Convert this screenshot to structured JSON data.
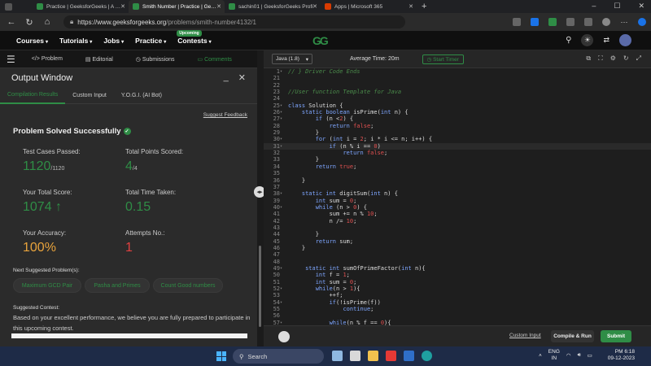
{
  "browser": {
    "tabs": [
      {
        "title": "Practice | GeeksforGeeks | A com",
        "color": "#2f8d46"
      },
      {
        "title": "Smith Number | Practice | Geeksf",
        "color": "#2f8d46",
        "active": true
      },
      {
        "title": "sachin01 | GeeksforGeeks Profi",
        "color": "#2f8d46"
      },
      {
        "title": "Apps | Microsoft 365",
        "color": "#d83b01"
      }
    ],
    "new_tab": "+",
    "url_host": "https://www.geeksforgeeks.org",
    "url_path": "/problems/smith-number4132/1"
  },
  "site": {
    "logo": "GG",
    "nav": [
      {
        "label": "Courses"
      },
      {
        "label": "Tutorials"
      },
      {
        "label": "Jobs"
      },
      {
        "label": "Practice"
      },
      {
        "label": "Contests",
        "badge": "Upcoming"
      }
    ]
  },
  "problem_tabs": [
    "Problem",
    "Editorial",
    "Submissions",
    "Comments"
  ],
  "output_window": {
    "title": "Output Window",
    "tabs": [
      "Compilation Results",
      "Custom Input",
      "Y.O.G.I. (AI Bot)"
    ],
    "suggest_feedback": "Suggest Feedback",
    "status": "Problem Solved Successfully",
    "stats": {
      "test_cases_label": "Test Cases Passed:",
      "test_cases_value": "1120",
      "test_cases_total": "/1120",
      "points_label": "Total Points Scored:",
      "points_value": "4",
      "points_total": "/4",
      "score_label": "Your Total Score:",
      "score_value": "1074",
      "time_label": "Total Time Taken:",
      "time_value": "0.15",
      "accuracy_label": "Your Accuracy:",
      "accuracy_value": "100%",
      "attempts_label": "Attempts No.:",
      "attempts_value": "1"
    },
    "next_label": "Next Suggested Problem(s):",
    "next_problems": [
      "Maximum GCD Pair",
      "Pasha and Primes",
      "Count Good numbers"
    ],
    "contest_label": "Suggested Contest:",
    "contest_text": "Based on your excellent performance, we believe you are fully prepared to participate in this upcoming contest."
  },
  "editor": {
    "language": "Java (1.8)",
    "avg_time": "Average Time: 20m",
    "timer_label": "Start Timer",
    "custom_input": "Custom Input",
    "compile_label": "Compile & Run",
    "submit_label": "Submit",
    "lines": [
      {
        "n": "1",
        "arrow": "›",
        "html": "<span class='c'>// } Driver Code Ends</span>"
      },
      {
        "n": "21",
        "html": ""
      },
      {
        "n": "22",
        "html": ""
      },
      {
        "n": "23",
        "html": "<span class='c'>//User function Template for Java</span>"
      },
      {
        "n": "24",
        "html": ""
      },
      {
        "n": "25",
        "arrow": "▾",
        "html": "<span class='k'>class</span> <span class='p'>Solution {</span>"
      },
      {
        "n": "26",
        "arrow": "▾",
        "html": "    <span class='k'>static boolean</span> <span class='p'>isPrime(</span><span class='k'>int</span> <span class='p'>n) {</span>"
      },
      {
        "n": "27",
        "arrow": "▾",
        "html": "        <span class='k'>if</span> <span class='p'>(n &lt;</span><span class='n'>2</span><span class='p'>) {</span>"
      },
      {
        "n": "28",
        "html": "            <span class='k'>return</span> <span class='s'>false</span><span class='p'>;</span>"
      },
      {
        "n": "29",
        "html": "        <span class='p'>}</span>"
      },
      {
        "n": "30",
        "arrow": "▾",
        "html": "        <span class='k'>for</span> <span class='p'>(</span><span class='k'>int</span> <span class='p'>i = </span><span class='n'>2</span><span class='p'>; i * i &lt;= n; i++) {</span>"
      },
      {
        "n": "31",
        "arrow": "▾",
        "hl": true,
        "html": "            <span class='k'>if</span> <span class='p'>(n % i == </span><span class='n'>0</span><span class='p'>)</span>"
      },
      {
        "n": "32",
        "html": "                <span class='k'>return</span> <span class='s'>false</span><span class='p'>;</span>"
      },
      {
        "n": "33",
        "html": "        <span class='p'>}</span>"
      },
      {
        "n": "34",
        "html": "        <span class='k'>return</span> <span class='s'>true</span><span class='p'>;</span>"
      },
      {
        "n": "35",
        "html": ""
      },
      {
        "n": "36",
        "html": "    <span class='p'>}</span>"
      },
      {
        "n": "37",
        "html": ""
      },
      {
        "n": "38",
        "arrow": "▾",
        "html": "    <span class='k'>static int</span> <span class='p'>digitSum(</span><span class='k'>int</span> <span class='p'>n) {</span>"
      },
      {
        "n": "39",
        "html": "        <span class='k'>int</span> <span class='p'>sum = </span><span class='n'>0</span><span class='p'>;</span>"
      },
      {
        "n": "40",
        "arrow": "▾",
        "html": "        <span class='k'>while</span> <span class='p'>(n &gt; </span><span class='n'>0</span><span class='p'>) {</span>"
      },
      {
        "n": "41",
        "html": "            <span class='p'>sum += n % </span><span class='n'>10</span><span class='p'>;</span>"
      },
      {
        "n": "42",
        "html": "            <span class='p'>n /= </span><span class='n'>10</span><span class='p'>;</span>"
      },
      {
        "n": "43",
        "html": ""
      },
      {
        "n": "44",
        "html": "        <span class='p'>}</span>"
      },
      {
        "n": "45",
        "html": "        <span class='k'>return</span> <span class='p'>sum;</span>"
      },
      {
        "n": "46",
        "html": "    <span class='p'>}</span>"
      },
      {
        "n": "47",
        "html": ""
      },
      {
        "n": "48",
        "html": ""
      },
      {
        "n": "49",
        "arrow": "▾",
        "html": "     <span class='k'>static int</span> <span class='p'>sumOfPrimeFactor(</span><span class='k'>int</span> <span class='p'>n){</span>"
      },
      {
        "n": "50",
        "html": "        <span class='k'>int</span> <span class='p'>f = </span><span class='n'>1</span><span class='p'>;</span>"
      },
      {
        "n": "51",
        "html": "        <span class='k'>int</span> <span class='p'>sum = </span><span class='n'>0</span><span class='p'>;</span>"
      },
      {
        "n": "52",
        "arrow": "▾",
        "html": "        <span class='k'>while</span><span class='p'>(n &gt; </span><span class='n'>1</span><span class='p'>){</span>"
      },
      {
        "n": "53",
        "html": "            <span class='p'>++f;</span>"
      },
      {
        "n": "54",
        "arrow": "▾",
        "html": "            <span class='k'>if</span><span class='p'>(!isPrime(f))</span>"
      },
      {
        "n": "55",
        "html": "                <span class='k'>continue</span><span class='p'>;</span>"
      },
      {
        "n": "56",
        "html": ""
      },
      {
        "n": "57",
        "arrow": "▾",
        "html": "            <span class='k'>while</span><span class='p'>(n % f == </span><span class='n'>0</span><span class='p'>){</span>"
      }
    ]
  },
  "taskbar": {
    "search": "Search",
    "lang1": "ENG",
    "lang2": "IN",
    "time": "PM 6:18",
    "date": "09-12-2023"
  }
}
